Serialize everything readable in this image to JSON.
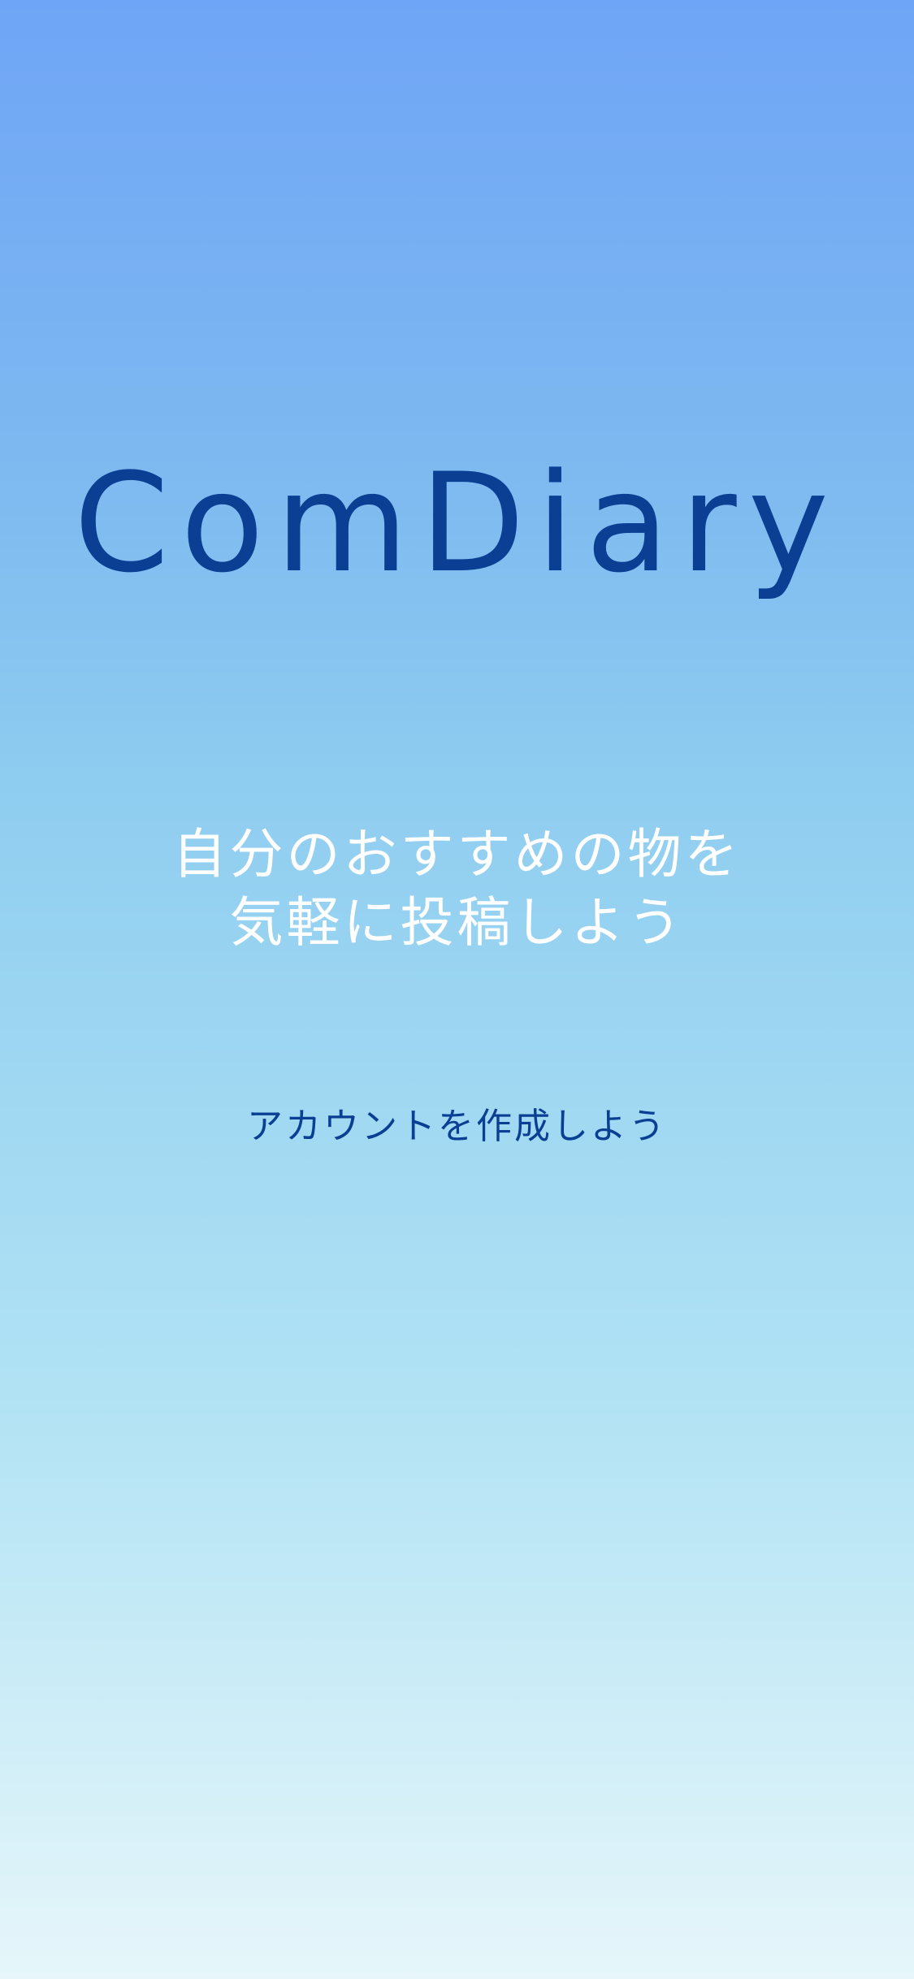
{
  "app": {
    "title": "ComDiary"
  },
  "welcome": {
    "tagline_line1": "自分のおすすめの物を",
    "tagline_line2": "気軽に投稿しよう",
    "create_account_label": "アカウントを作成しよう"
  },
  "colors": {
    "gradient_top": "#6fa5f6",
    "gradient_bottom": "#e6f6fa",
    "title_color": "#0a3f93",
    "tagline_color": "#ffffff"
  }
}
